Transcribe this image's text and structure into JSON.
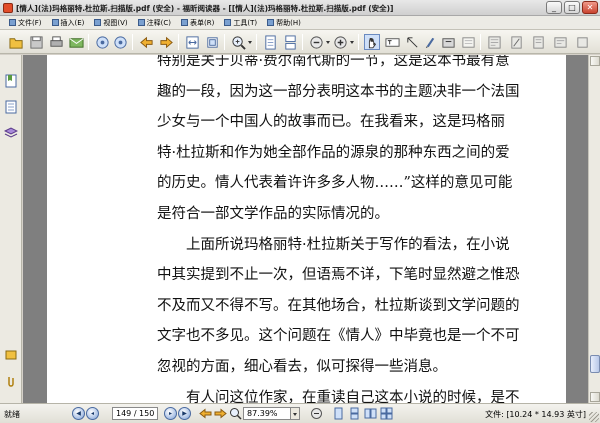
{
  "window": {
    "title": "[情人](法)玛格丽特.杜拉斯.扫描版.pdf (安全) - 福昕阅读器 - [[情人](法)玛格丽特.杜拉斯.扫描版.pdf (安全)]",
    "minimize": "_",
    "maximize": "□",
    "close": "✕"
  },
  "menu": [
    {
      "label": "文件(F)"
    },
    {
      "label": "插入(E)"
    },
    {
      "label": "视图(V)"
    },
    {
      "label": "注释(C)"
    },
    {
      "label": "表单(R)"
    },
    {
      "label": "工具(T)"
    },
    {
      "label": "帮助(H)"
    }
  ],
  "toolbar_icons": [
    "open-icon",
    "save-icon",
    "print-icon",
    "email-icon",
    "first-page-icon",
    "last-page-icon",
    "back-icon",
    "forward-icon",
    "fit-width-icon",
    "actual-size-icon",
    "zoom-in-icon",
    "single-page-icon",
    "continuous-page-icon",
    "zoom-out-circle-icon",
    "zoom-in-circle-icon",
    "hand-tool-icon",
    "select-text-icon",
    "snapshot-icon",
    "annotation-icon",
    "typewriter-icon",
    "highlight-icon",
    "comment-icon",
    "stamp-icon",
    "measure-icon",
    "form-icon"
  ],
  "document": {
    "paragraph1": [
      "特别是关于贝蒂·费尔南代斯的一节，这是这本书最有意",
      "趣的一段，因为这一部分表明这本书的主题决非一个法国",
      "少女与一个中国人的故事而已。在我看来，这是玛格丽",
      "特·杜拉斯和作为她全部作品的源泉的那种东西之间的爱",
      "的历史。情人代表着许许多多人物……”这样的意见可能",
      "是符合一部文学作品的实际情况的。"
    ],
    "paragraph2": [
      "上面所说玛格丽特·杜拉斯关于写作的看法，在小说",
      "中其实提到不止一次，但语焉不详，下笔时显然避之惟恐",
      "不及而又不得不写。在其他场合，杜拉斯谈到文学问题的",
      "文字也不多见。这个问题在《情人》中毕竟也是一个不可",
      "忽视的方面，细心看去，似可探得一些消息。"
    ],
    "paragraph3": [
      "有人问这位作家，在重读自己这本小说的时候，是不"
    ]
  },
  "status": {
    "ready": "就绪",
    "page_field": "149 / 150",
    "zoom": "87.39%",
    "file_info": "文件: [10.24 * 14.93 英寸]"
  },
  "colors": {
    "accent": "#7fa2d8",
    "page_bg": "#ffffff",
    "viewport_bg": "#7f7f7f",
    "close_button": "#c9432f"
  }
}
